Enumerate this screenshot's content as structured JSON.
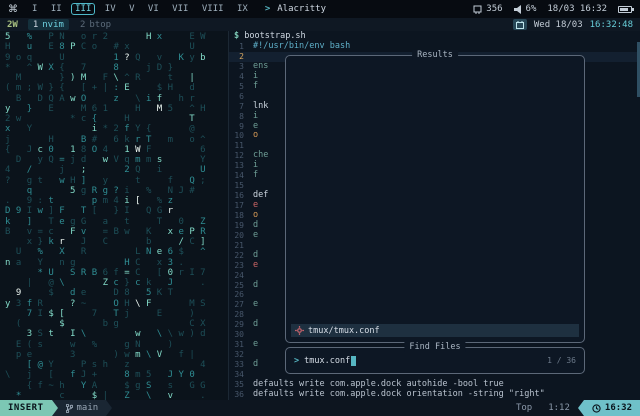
{
  "topbar": {
    "logo": "⌘",
    "workspaces": [
      "I",
      "II",
      "III",
      "IV",
      "V",
      "VI",
      "VII",
      "VIII",
      "IX"
    ],
    "active_workspace": "III",
    "chevron": ">",
    "app": "Alacritty",
    "mem": "356",
    "volume": "6%",
    "datetime": "18/03 16:32"
  },
  "tmux": {
    "session": "2W",
    "windows": [
      {
        "num": "1",
        "name": "nvim",
        "active": true
      },
      {
        "num": "2",
        "name": "btop",
        "active": false
      }
    ],
    "date": "Wed 18/03",
    "time": "16:32:48"
  },
  "editor": {
    "winbar_prompt": "$",
    "winbar_file": "bootstrap.sh",
    "total_lines": 36,
    "lines": [
      {
        "n": 1,
        "t": "#!/usr/bin/env bash",
        "c": "c-blue"
      },
      {
        "n": 2,
        "t": "",
        "c": "",
        "cursor": true
      },
      {
        "n": 3,
        "t": "ens",
        "c": "c-teal"
      },
      {
        "n": 4,
        "t": "i",
        "c": "c-teal"
      },
      {
        "n": 5,
        "t": "f",
        "c": "c-teal"
      },
      {
        "n": 6,
        "t": "",
        "c": ""
      },
      {
        "n": 7,
        "t": "lnk",
        "c": "c-white"
      },
      {
        "n": 8,
        "t": "i",
        "c": "c-teal"
      },
      {
        "n": 9,
        "t": "e",
        "c": "c-teal"
      },
      {
        "n": 10,
        "t": "o",
        "c": "c-orange"
      },
      {
        "n": 11,
        "t": "",
        "c": ""
      },
      {
        "n": 12,
        "t": "che",
        "c": "c-teal"
      },
      {
        "n": 13,
        "t": "i",
        "c": "c-teal"
      },
      {
        "n": 14,
        "t": "f",
        "c": "c-teal"
      },
      {
        "n": 15,
        "t": "",
        "c": ""
      },
      {
        "n": 16,
        "t": "def",
        "c": "c-white"
      },
      {
        "n": 17,
        "t": "e",
        "c": "c-red"
      },
      {
        "n": 18,
        "t": "o",
        "c": "c-orange"
      },
      {
        "n": 19,
        "t": "d",
        "c": "c-teal"
      },
      {
        "n": 20,
        "t": "e",
        "c": "c-teal"
      },
      {
        "n": 21,
        "t": "",
        "c": ""
      },
      {
        "n": 22,
        "t": "d",
        "c": "c-teal"
      },
      {
        "n": 23,
        "t": "e",
        "c": "c-red"
      },
      {
        "n": 24,
        "t": "",
        "c": ""
      },
      {
        "n": 25,
        "t": "d",
        "c": "c-teal"
      },
      {
        "n": 26,
        "t": "",
        "c": ""
      },
      {
        "n": 27,
        "t": "e",
        "c": "c-teal"
      },
      {
        "n": 28,
        "t": "",
        "c": ""
      },
      {
        "n": 29,
        "t": "d",
        "c": "c-teal"
      },
      {
        "n": 30,
        "t": "",
        "c": ""
      },
      {
        "n": 31,
        "t": "e",
        "c": "c-teal"
      },
      {
        "n": 32,
        "t": "",
        "c": ""
      },
      {
        "n": 33,
        "t": "d",
        "c": "c-teal"
      },
      {
        "n": 34,
        "t": "",
        "c": ""
      },
      {
        "n": 35,
        "t": "defaults write com.apple.dock autohide -bool true",
        "c": "c-norm"
      },
      {
        "n": 36,
        "t": "defaults write com.apple.dock orientation -string \"right\"",
        "c": "c-norm"
      }
    ]
  },
  "results": {
    "title": "Results",
    "selected": "tmux/tmux.conf"
  },
  "finder": {
    "title": "Find Files",
    "prompt": ">",
    "query": "tmux.conf",
    "counter": "1 / 36"
  },
  "statusline": {
    "mode": "INSERT",
    "branch": "main",
    "position": "Top",
    "cursor": "1:12",
    "time": "16:32"
  },
  "matrix": {
    "charset": "abcdefghijklmnopqrstuvwxyzABCDEFGHIJKLMNOPQRSTUVWXYZ0123456789@#$%*+=?/\\|{}[]()~^.:;",
    "rows": 36,
    "cols": 19,
    "seed": 1337
  }
}
